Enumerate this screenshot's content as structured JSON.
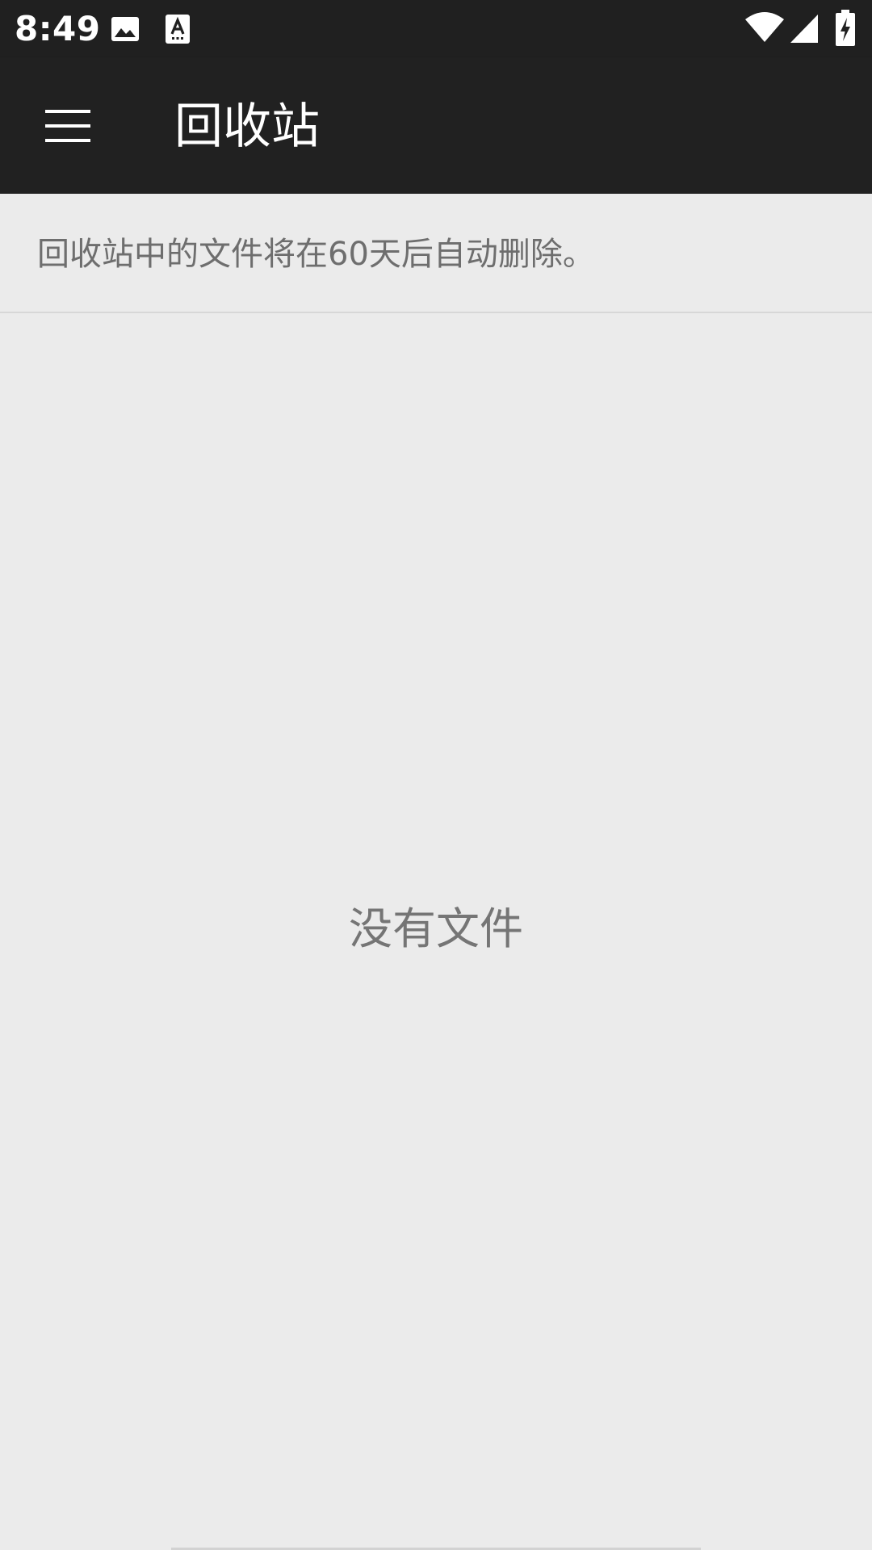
{
  "status_bar": {
    "time": "8:49",
    "icons": [
      "image-icon",
      "keyboard-a-icon",
      "wifi-icon",
      "signal-icon",
      "battery-charging-icon"
    ]
  },
  "app_bar": {
    "menu_icon": "hamburger-menu-icon",
    "title": "回收站"
  },
  "notice": {
    "text": "回收站中的文件将在60天后自动删除。"
  },
  "empty_state": {
    "text": "没有文件"
  },
  "colors": {
    "status_bar_bg": "#202020",
    "app_bar_bg": "#212121",
    "page_bg": "#ebebeb",
    "secondary_text": "#6e6e6e"
  }
}
